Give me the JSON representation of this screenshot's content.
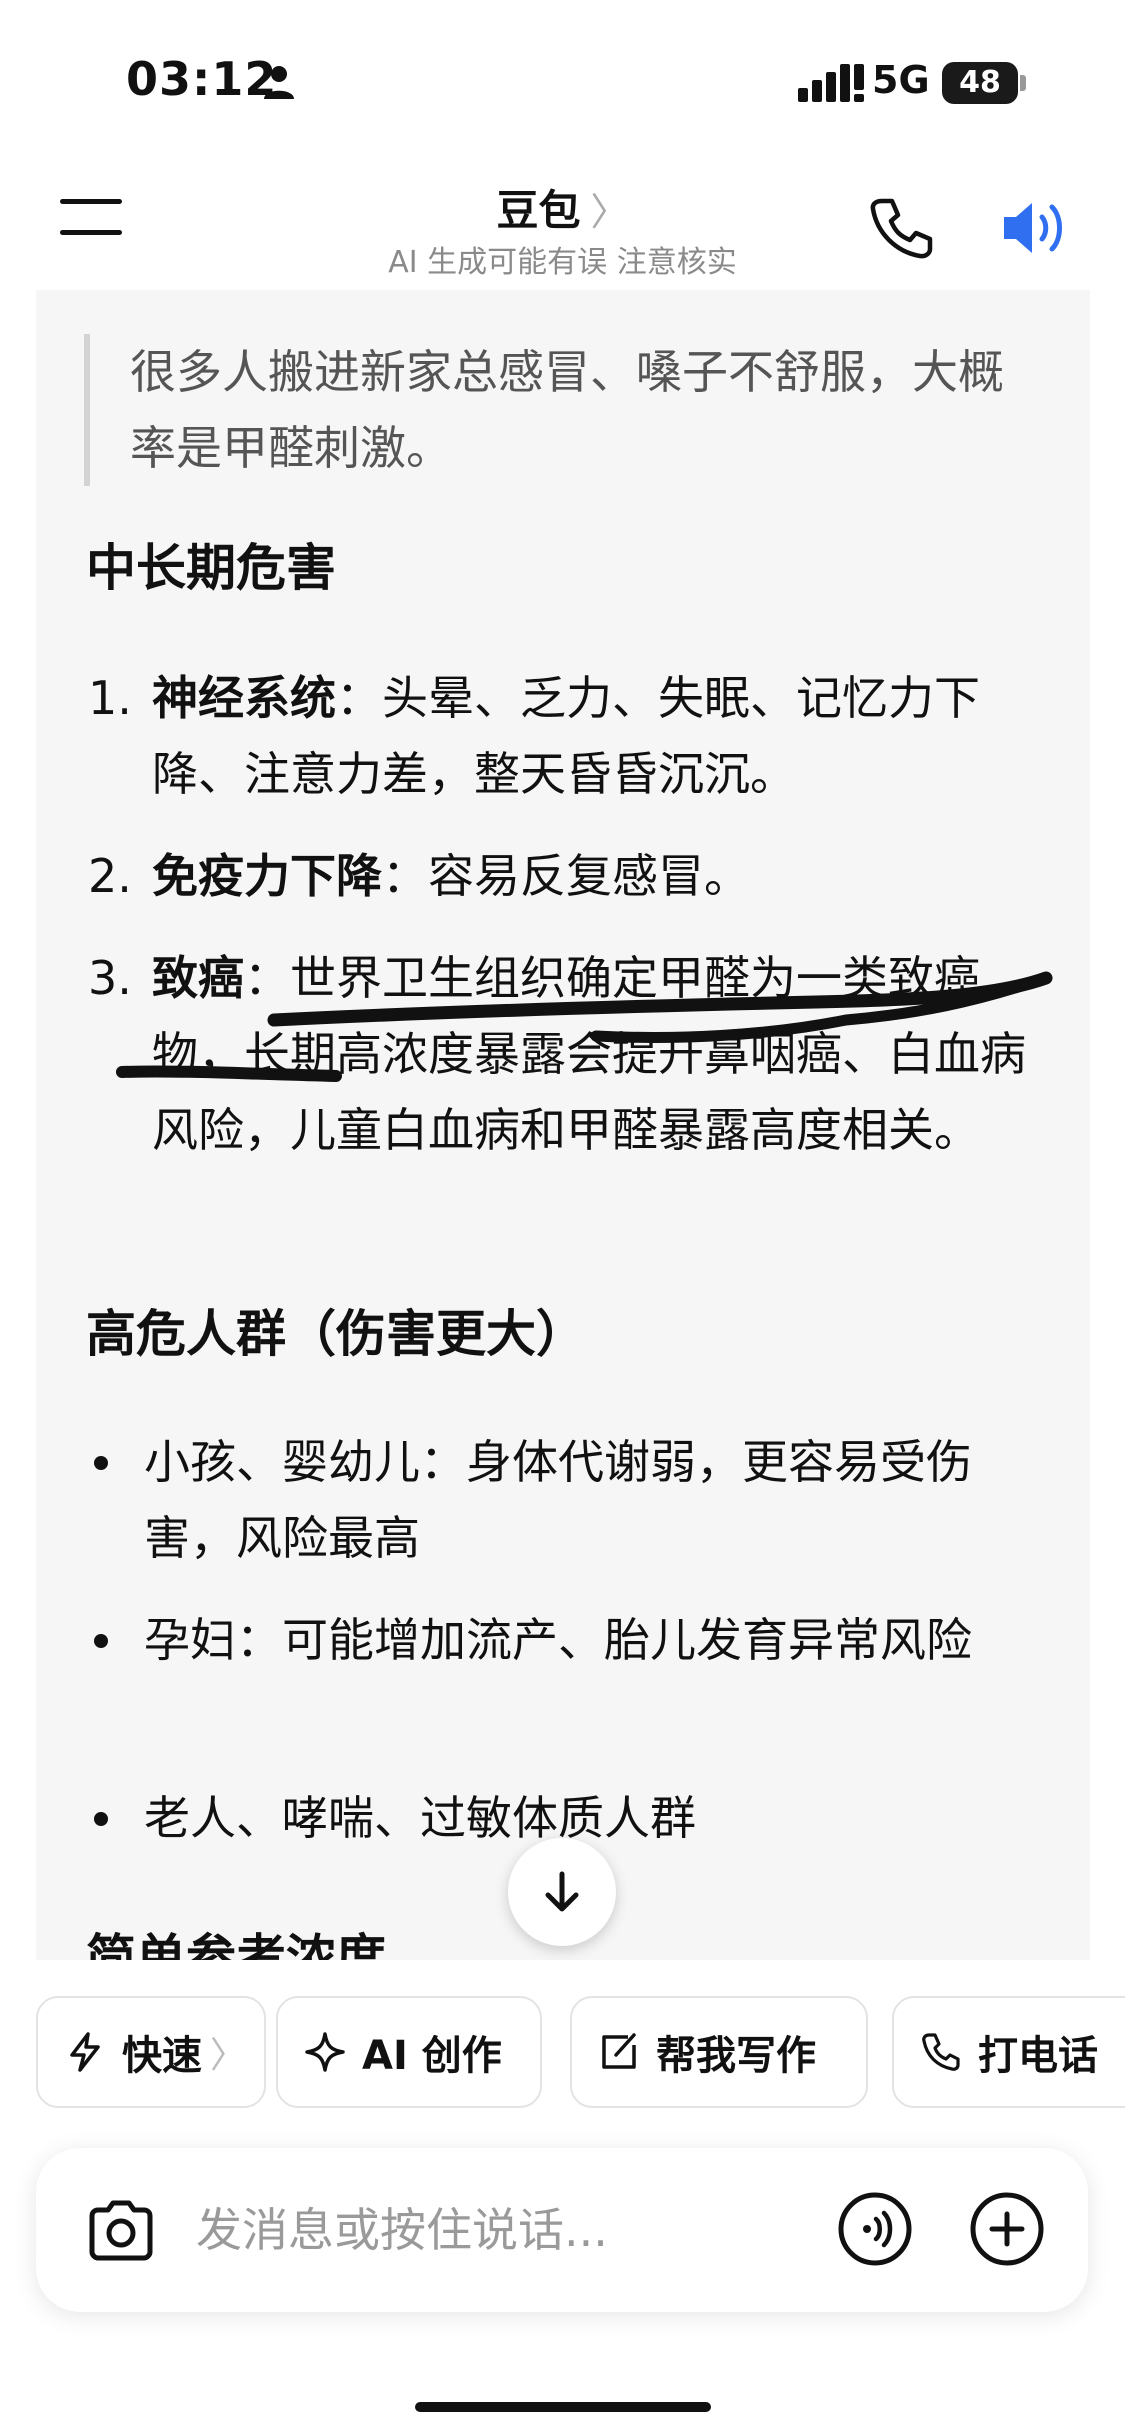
{
  "status_bar": {
    "time": "03:12",
    "network": "5G",
    "battery": "48"
  },
  "header": {
    "title": "豆包",
    "title_chevron": "〉",
    "subtitle": "AI 生成可能有误 注意核实"
  },
  "content": {
    "quote": "很多人搬进新家总感冒、嗓子不舒服，大概率是甲醛刺激。",
    "section1": {
      "heading": "中长期危害",
      "items": [
        {
          "num": "1.",
          "bold": "神经系统",
          "text": "：头晕、乏力、失眠、记忆力下降、注意力差，整天昏昏沉沉。"
        },
        {
          "num": "2.",
          "bold": "免疫力下降",
          "text": "：容易反复感冒。"
        },
        {
          "num": "3.",
          "bold": "致癌",
          "text": "：世界卫生组织确定甲醛为一类致癌物，长期高浓度暴露会提升鼻咽癌、白血病风险，儿童白血病和甲醛暴露高度相关。"
        }
      ]
    },
    "section2": {
      "heading": "高危人群（伤害更大）",
      "items": [
        "小孩、婴幼儿：身体代谢弱，更容易受伤害，风险最高",
        "孕妇：可能增加流产、胎儿发育异常风险",
        "老人、哮喘、过敏体质人群"
      ]
    },
    "cut_heading": "简单参考浓度"
  },
  "chips": [
    {
      "label": "快速",
      "icon": "lightning-icon",
      "chevron": "〉"
    },
    {
      "label": "AI 创作",
      "icon": "sparkle-icon"
    },
    {
      "label": "帮我写作",
      "icon": "edit-icon"
    },
    {
      "label": "打电话",
      "icon": "phone-icon"
    }
  ],
  "input": {
    "placeholder": "发消息或按住说话..."
  },
  "colors": {
    "accent_blue": "#2f6ff0",
    "card_bg": "#f6f6f6",
    "muted_text": "#8a8a8a",
    "scribble": "#111111"
  }
}
